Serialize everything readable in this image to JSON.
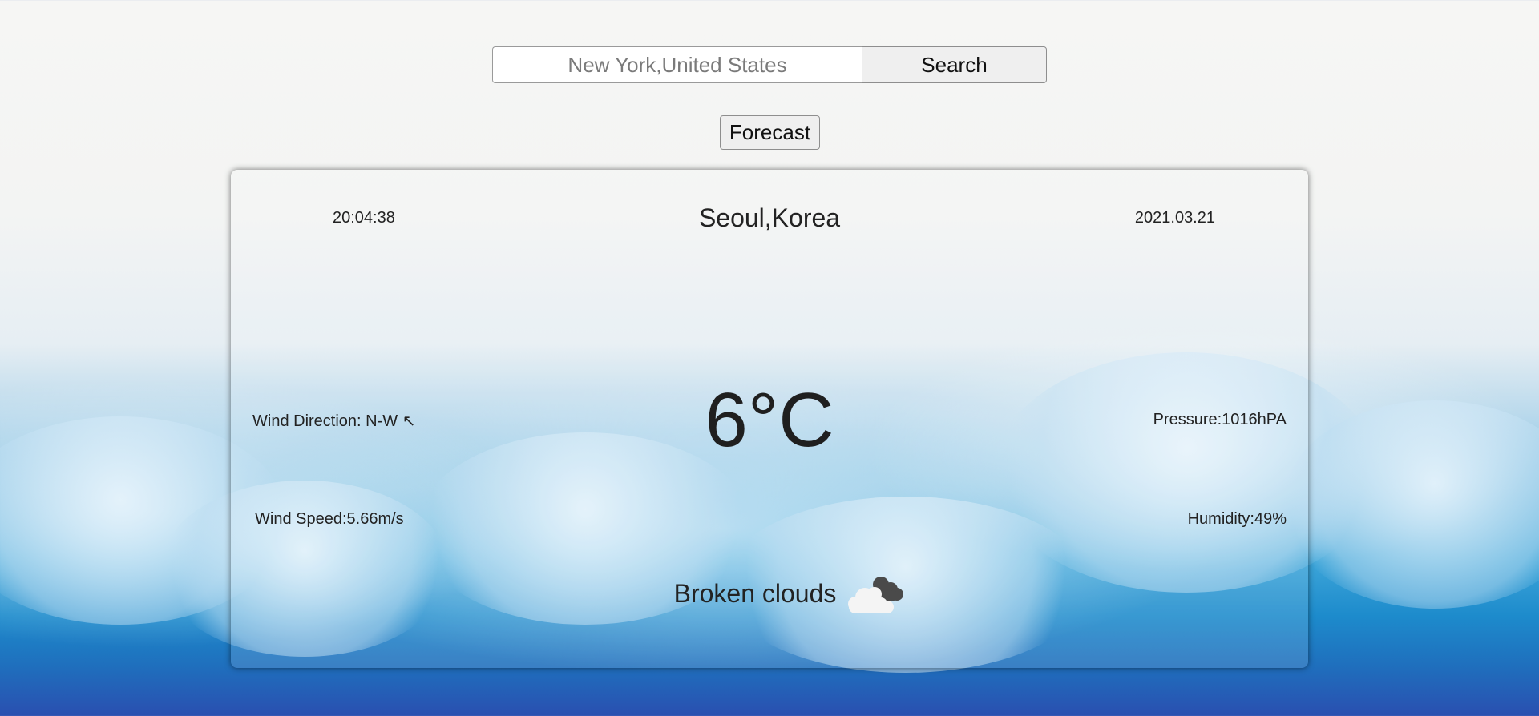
{
  "search": {
    "placeholder": "New York,United States",
    "value": "",
    "button_label": "Search"
  },
  "forecast_button_label": "Forecast",
  "weather": {
    "time": "20:04:38",
    "city": "Seoul,Korea",
    "date": "2021.03.21",
    "temperature": "6°C",
    "wind_direction": "Wind Direction: N-W ↖",
    "pressure": "Pressure:1016hPA",
    "wind_speed": "Wind Speed:5.66m/s",
    "humidity": "Humidity:49%",
    "condition": "Broken clouds",
    "condition_icon": "broken-clouds-icon"
  }
}
